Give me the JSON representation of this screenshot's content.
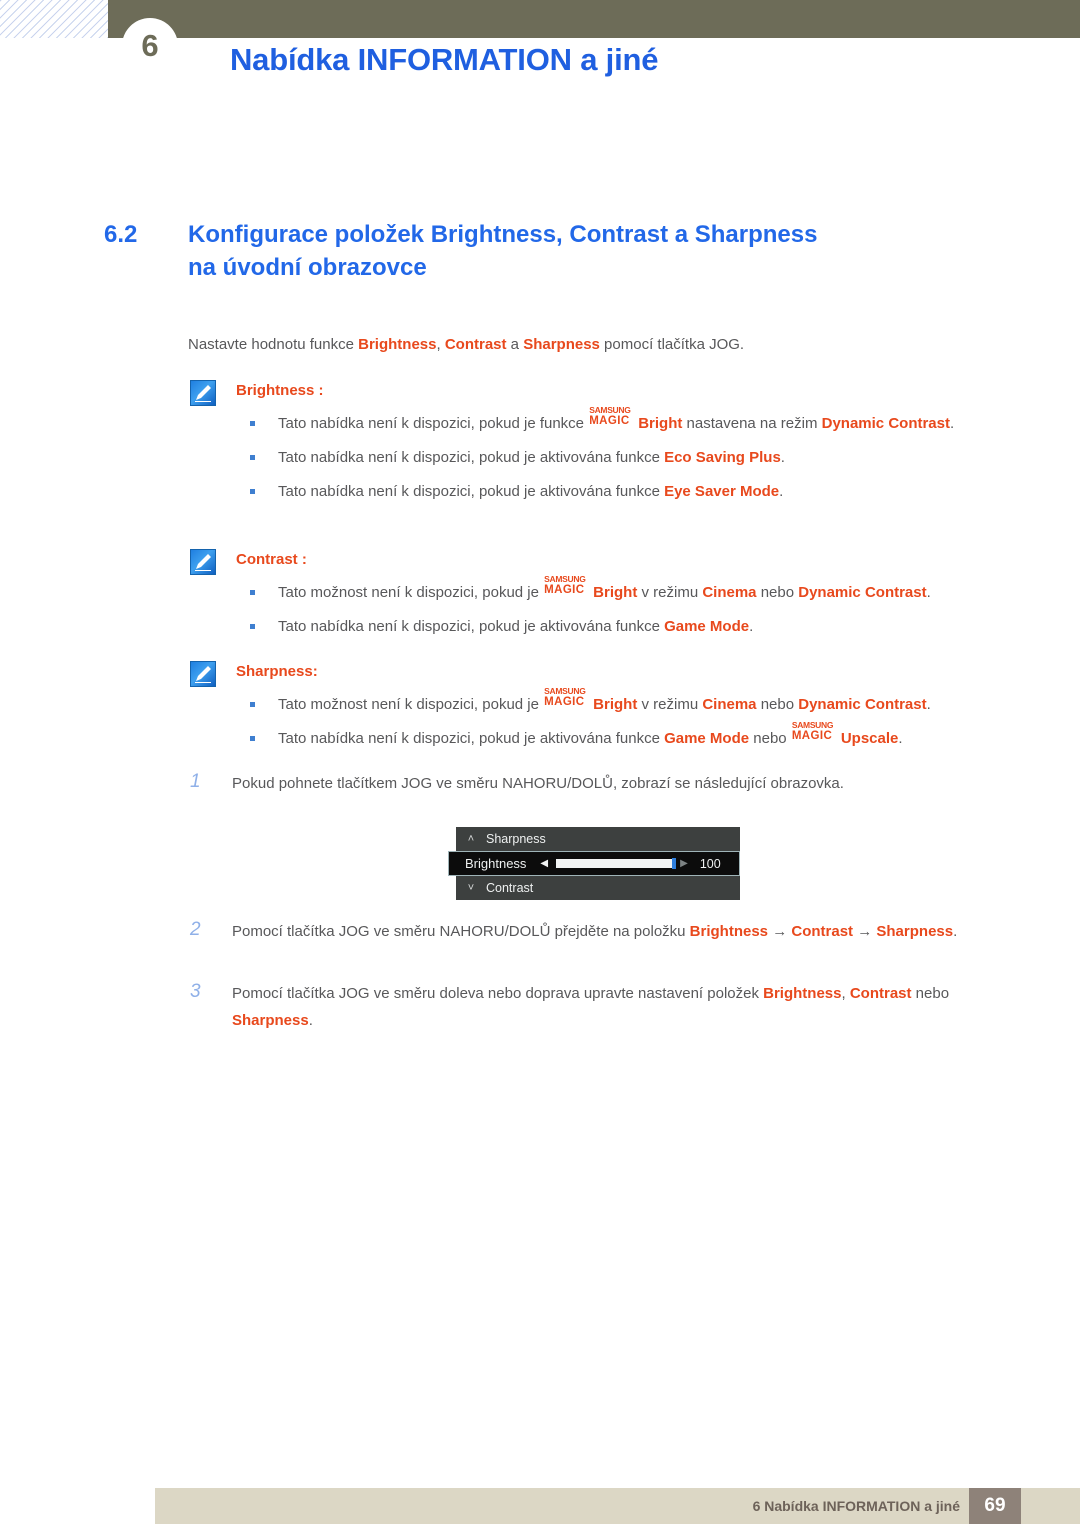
{
  "header": {
    "chapter_number": "6",
    "title": "Nabídka INFORMATION a jiné"
  },
  "section": {
    "number": "6.2",
    "title_line1": "Konfigurace položek Brightness, Contrast a Sharpness",
    "title_line2": "na úvodní obrazovce"
  },
  "intro": {
    "t1": "Nastavte hodnotu funkce ",
    "kw1": "Brightness",
    "t2": ", ",
    "kw2": "Contrast",
    "t3": " a ",
    "kw3": "Sharpness",
    "t4": " pomocí tlačítka JOG."
  },
  "magic_logo": {
    "top": "SAMSUNG",
    "bottom": "MAGIC"
  },
  "notes": [
    {
      "icon": "note-pencil-icon",
      "title": "Brightness",
      "title_suffix": " :",
      "bullets": [
        {
          "parts": [
            {
              "t": "Tato nabídka není k dispozici, pokud je funkce ",
              "k": false
            },
            {
              "t": "__MAGIC__",
              "k": false
            },
            {
              "t": "Bright",
              "k": true
            },
            {
              "t": " nastavena na režim ",
              "k": false
            },
            {
              "t": "Dynamic Contrast",
              "k": true
            },
            {
              "t": ".",
              "k": false
            }
          ]
        },
        {
          "parts": [
            {
              "t": "Tato nabídka není k dispozici, pokud je aktivována funkce ",
              "k": false
            },
            {
              "t": "Eco Saving Plus",
              "k": true
            },
            {
              "t": ".",
              "k": false
            }
          ]
        },
        {
          "parts": [
            {
              "t": "Tato nabídka není k dispozici, pokud je aktivována funkce ",
              "k": false
            },
            {
              "t": "Eye Saver Mode",
              "k": true
            },
            {
              "t": ".",
              "k": false
            }
          ]
        }
      ]
    },
    {
      "icon": "note-pencil-icon",
      "title": "Contrast",
      "title_suffix": " :",
      "bullets": [
        {
          "parts": [
            {
              "t": "Tato možnost není k dispozici, pokud je ",
              "k": false
            },
            {
              "t": "__MAGIC__",
              "k": false
            },
            {
              "t": "Bright",
              "k": true
            },
            {
              "t": " v režimu ",
              "k": false
            },
            {
              "t": "Cinema",
              "k": true
            },
            {
              "t": " nebo ",
              "k": false
            },
            {
              "t": "Dynamic Contrast",
              "k": true
            },
            {
              "t": ".",
              "k": false
            }
          ]
        },
        {
          "parts": [
            {
              "t": "Tato nabídka není k dispozici, pokud je aktivována funkce ",
              "k": false
            },
            {
              "t": "Game Mode",
              "k": true
            },
            {
              "t": ".",
              "k": false
            }
          ]
        }
      ]
    },
    {
      "icon": "note-pencil-icon",
      "title": "Sharpness",
      "title_suffix": ":",
      "bullets": [
        {
          "parts": [
            {
              "t": "Tato možnost není k dispozici, pokud je ",
              "k": false
            },
            {
              "t": "__MAGIC__",
              "k": false
            },
            {
              "t": "Bright",
              "k": true
            },
            {
              "t": " v režimu ",
              "k": false
            },
            {
              "t": "Cinema",
              "k": true
            },
            {
              "t": " nebo ",
              "k": false
            },
            {
              "t": "Dynamic Contrast",
              "k": true
            },
            {
              "t": ".",
              "k": false
            }
          ]
        },
        {
          "parts": [
            {
              "t": "Tato nabídka není k dispozici, pokud je aktivována funkce ",
              "k": false
            },
            {
              "t": "Game Mode",
              "k": true
            },
            {
              "t": " nebo ",
              "k": false
            },
            {
              "t": "__MAGIC__",
              "k": false
            },
            {
              "t": "Upscale",
              "k": true
            },
            {
              "t": ".",
              "k": false
            }
          ]
        }
      ]
    }
  ],
  "steps": [
    {
      "number": "1",
      "parts": [
        {
          "t": "Pokud pohnete tlačítkem JOG ve směru NAHORU/DOLŮ, zobrazí se následující obrazovka.",
          "k": false
        }
      ]
    },
    {
      "number": "2",
      "parts": [
        {
          "t": "Pomocí tlačítka JOG ve směru NAHORU/DOLŮ přejděte na položku ",
          "k": false
        },
        {
          "t": "Brightness",
          "k": true
        },
        {
          "t": " → ",
          "k": false
        },
        {
          "t": "Contrast",
          "k": true
        },
        {
          "t": " → ",
          "k": false
        },
        {
          "t": "Sharpness",
          "k": true
        },
        {
          "t": ".",
          "k": false
        }
      ]
    },
    {
      "number": "3",
      "parts": [
        {
          "t": "Pomocí tlačítka JOG ve směru doleva nebo doprava upravte nastavení položek ",
          "k": false
        },
        {
          "t": "Brightness",
          "k": true
        },
        {
          "t": ", ",
          "k": false
        },
        {
          "t": "Contrast",
          "k": true
        },
        {
          "t": " nebo ",
          "k": false
        },
        {
          "t": "Sharpness",
          "k": true
        },
        {
          "t": ".",
          "k": false
        }
      ]
    }
  ],
  "osd": {
    "rows": [
      {
        "icon": "chevron-up-icon",
        "chevron": "˄",
        "label": "Sharpness",
        "active": false
      },
      {
        "icon": "slider-row",
        "chevron": "",
        "label": "Brightness",
        "active": true,
        "arrow_left": "◀",
        "arrow_right": "▶",
        "value": "100",
        "fill_percent": 100
      },
      {
        "icon": "chevron-down-icon",
        "chevron": "˅",
        "label": "Contrast",
        "active": false
      }
    ]
  },
  "footer": {
    "text": "6 Nabídka INFORMATION a jiné",
    "page": "69"
  },
  "colors": {
    "header_bar": "#6d6c58",
    "heading_blue": "#2268e8",
    "keyword_orange": "#e8491d",
    "body_gray": "#58585a",
    "step_number_blue": "#8fb0e8",
    "bullet_blue": "#3f7fd0",
    "footer_bar": "#dcd7c5",
    "footer_page_box": "#8e8279",
    "osd_bg": "#3d403f",
    "osd_active_bg": "#0c0c0c",
    "osd_thumb": "#2f7fdd"
  }
}
